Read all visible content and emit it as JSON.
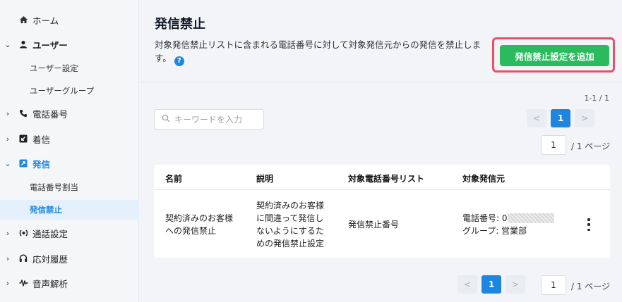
{
  "sidebar": {
    "home": "ホーム",
    "users": "ユーザー",
    "user_settings": "ユーザー設定",
    "user_groups": "ユーザーグループ",
    "phone_numbers": "電話番号",
    "incoming": "着信",
    "outgoing": "発信",
    "number_assignment": "電話番号割当",
    "call_block": "発信禁止",
    "call_settings": "通話設定",
    "history": "応対履歴",
    "voice_analysis": "音声解析"
  },
  "page": {
    "title": "発信禁止",
    "description": "対象発信禁止リストに含まれる電話番号に対して対象発信元からの発信を禁止します。",
    "add_button": "発信禁止設定を追加"
  },
  "list": {
    "count": "1-1 / 1",
    "search_placeholder": "キーワードを入力",
    "current_page": "1",
    "page_input_value": "1",
    "page_total": "/ 1 ページ",
    "prev": "<",
    "next": ">"
  },
  "table": {
    "headers": [
      "名前",
      "説明",
      "対象電話番号リスト",
      "対象発信元"
    ],
    "rows": [
      {
        "name_line1": "契約済みのお客様",
        "name_line2": "への発信禁止",
        "desc_line1": "契約済みのお客様",
        "desc_line2": "に間違って発信し",
        "desc_line3": "ないようにするた",
        "desc_line4": "めの発信禁止設定",
        "list": "発信禁止番号",
        "source_phone": "電話番号: 0",
        "source_group": "グループ: 営業部"
      }
    ]
  },
  "colors": {
    "accent": "#1f86e0",
    "add_button": "#2bbb5e",
    "highlight": "#e8506a"
  }
}
